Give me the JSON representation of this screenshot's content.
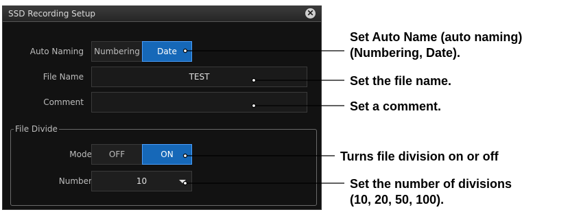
{
  "dialog": {
    "title": "SSD Recording Setup",
    "close_glyph": "✕"
  },
  "auto_naming": {
    "label": "Auto Naming",
    "options": [
      "Numbering",
      "Date"
    ],
    "selected": "Date"
  },
  "file_name": {
    "label": "File Name",
    "value": "TEST"
  },
  "comment": {
    "label": "Comment",
    "value": ""
  },
  "file_divide": {
    "group_label": "File Divide",
    "mode": {
      "label": "Mode",
      "options": [
        "OFF",
        "ON"
      ],
      "selected": "ON"
    },
    "number": {
      "label": "Number",
      "value": "10"
    }
  },
  "annotations": {
    "auto_name_line1": "Set Auto Name (auto naming)",
    "auto_name_line2": "(Numbering, Date).",
    "file_name": "Set the file name.",
    "comment": "Set a comment.",
    "mode": "Turns file division on or off",
    "number_line1": "Set the number of divisions",
    "number_line2": "(10, 20, 50, 100)."
  },
  "colors": {
    "panel_bg": "#121212",
    "selected_blue": "#1668b8",
    "label_gray": "#bcbcbc"
  }
}
